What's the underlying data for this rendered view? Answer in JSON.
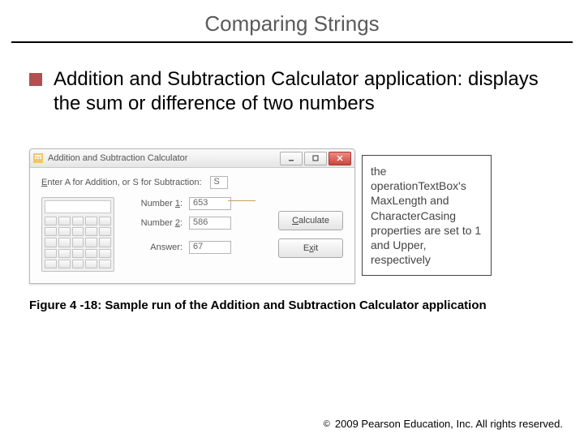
{
  "title": "Comparing Strings",
  "bullet": "Addition and Subtraction Calculator application: displays the sum or difference of two numbers",
  "window": {
    "title": "Addition and Subtraction Calculator",
    "prompt_pre": "Enter A for Addition, or S for Subtraction:",
    "op_value": "S",
    "num1_label_pre": "Number ",
    "num1_underline": "1",
    "num1_label_post": ":",
    "num1_value": "653",
    "num2_label_pre": "Number ",
    "num2_underline": "2",
    "num2_label_post": ":",
    "num2_value": "586",
    "answer_label": "Answer:",
    "answer_value": "67",
    "calc_btn_underline": "C",
    "calc_btn_rest": "alculate",
    "exit_btn_pre": "E",
    "exit_btn_underline": "x",
    "exit_btn_post": "it"
  },
  "callout": "the operationTextBox's MaxLength and CharacterCasing properties are set to 1 and Upper, respectively",
  "caption": "Figure 4 -18: Sample run of the Addition and Subtraction Calculator application",
  "footer_copy": "2009 Pearson Education, Inc.  All rights reserved."
}
